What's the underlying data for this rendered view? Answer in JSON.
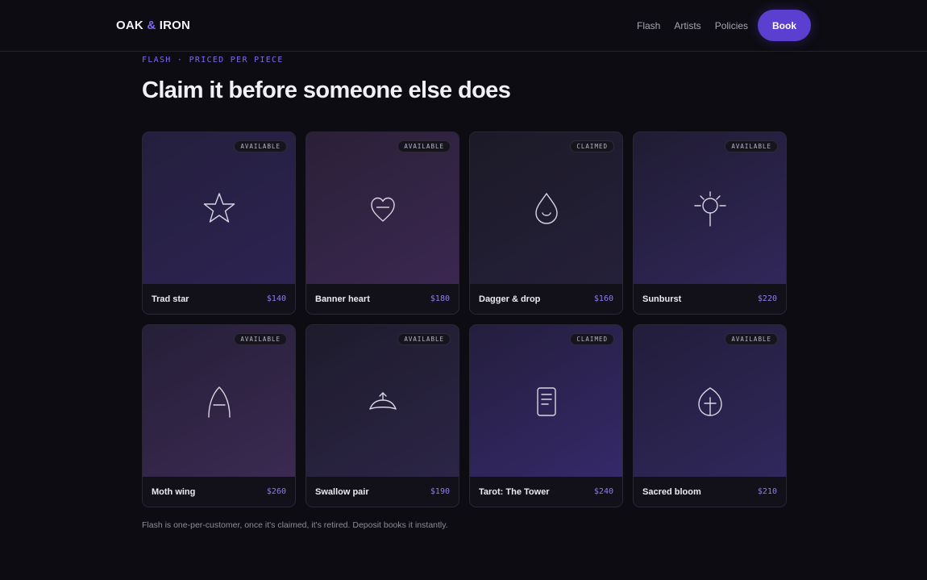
{
  "nav": {
    "brand_left": "OAK",
    "brand_amp": "&",
    "brand_right": "IRON",
    "links": [
      "Flash",
      "Artists",
      "Policies"
    ],
    "book_label": "Book"
  },
  "hero": {
    "eyebrow": "FLASH · PRICED PER PIECE",
    "headline": "Claim it before someone else does"
  },
  "colors": {
    "accent": "#5b3fd0",
    "price": "#8d7ef2",
    "background": "#0d0c12"
  },
  "cards": [
    {
      "name": "Trad star",
      "price": "$140",
      "status": "AVAILABLE",
      "icon": "star-icon"
    },
    {
      "name": "Banner heart",
      "price": "$180",
      "status": "AVAILABLE",
      "icon": "heart-icon"
    },
    {
      "name": "Dagger & drop",
      "price": "$160",
      "status": "CLAIMED",
      "icon": "drop-icon"
    },
    {
      "name": "Sunburst",
      "price": "$220",
      "status": "AVAILABLE",
      "icon": "sun-icon"
    },
    {
      "name": "Moth wing",
      "price": "$260",
      "status": "AVAILABLE",
      "icon": "wing-icon"
    },
    {
      "name": "Swallow pair",
      "price": "$190",
      "status": "AVAILABLE",
      "icon": "swallow-icon"
    },
    {
      "name": "Tarot: The Tower",
      "price": "$240",
      "status": "CLAIMED",
      "icon": "tarot-card-icon"
    },
    {
      "name": "Sacred bloom",
      "price": "$210",
      "status": "AVAILABLE",
      "icon": "bloom-icon"
    }
  ],
  "note": "Flash is one-per-customer, once it's claimed, it's retired. Deposit books it instantly."
}
